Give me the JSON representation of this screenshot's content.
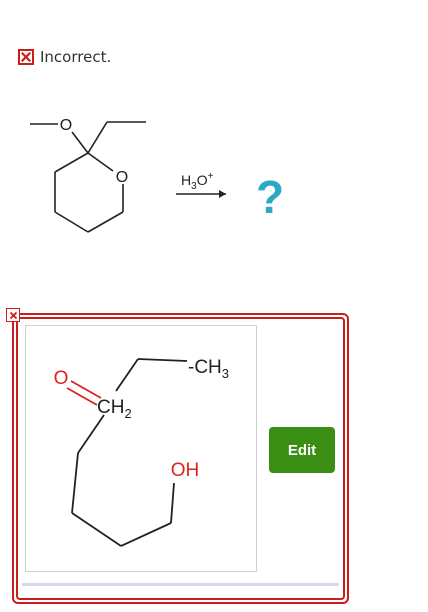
{
  "status": {
    "text": "Incorrect.",
    "color": "#cc1d1d"
  },
  "reaction": {
    "reagent_main": "H",
    "reagent_sub": "3",
    "reagent_main2": "O",
    "reagent_sup": "+",
    "unknown_product": "?",
    "unknown_color": "#2aa8c8",
    "reactant_atoms": {
      "ring_oxygen": "O",
      "ether_oxygen": "O"
    }
  },
  "answer": {
    "atoms": {
      "carbonyl_oxygen": "O",
      "ch2_main": "CH",
      "ch2_sub": "2",
      "ch3_main": "CH",
      "ch3_sub": "3",
      "hydroxyl": "OH"
    },
    "oxygen_color": "#e02020",
    "edit_label": "Edit",
    "edit_color": "#3b8e14"
  },
  "icons": [
    "incorrect-x-icon",
    "answer-incorrect-x-icon"
  ]
}
